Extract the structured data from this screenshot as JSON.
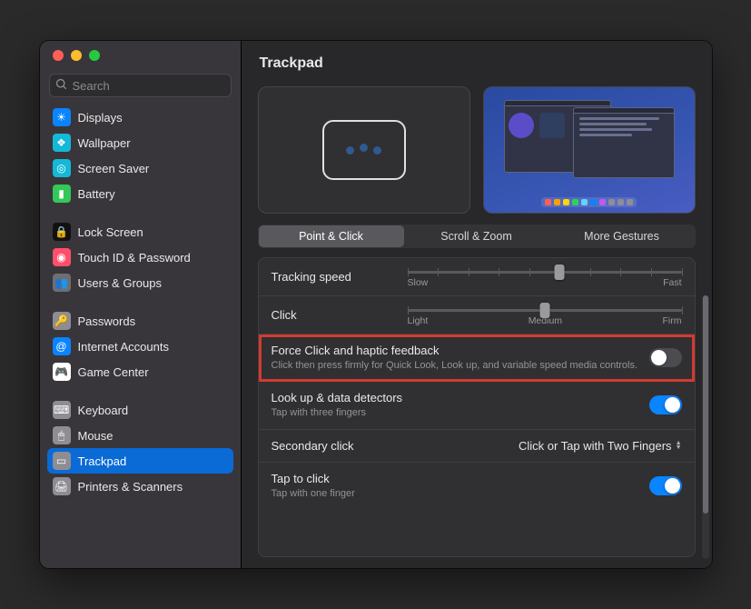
{
  "search": {
    "placeholder": "Search"
  },
  "header": {
    "title": "Trackpad"
  },
  "sidebar": {
    "groups": [
      [
        {
          "label": "Displays",
          "icon_bg": "#0a84ff",
          "glyph": "☀"
        },
        {
          "label": "Wallpaper",
          "icon_bg": "#14b8d8",
          "glyph": "❖"
        },
        {
          "label": "Screen Saver",
          "icon_bg": "#14b8d8",
          "glyph": "◎"
        },
        {
          "label": "Battery",
          "icon_bg": "#34c759",
          "glyph": "▮"
        }
      ],
      [
        {
          "label": "Lock Screen",
          "icon_bg": "#111111",
          "glyph": "🔒"
        },
        {
          "label": "Touch ID & Password",
          "icon_bg": "#ff4f6b",
          "glyph": "◉"
        },
        {
          "label": "Users & Groups",
          "icon_bg": "#6f6e73",
          "glyph": "👥"
        }
      ],
      [
        {
          "label": "Passwords",
          "icon_bg": "#8e8d91",
          "glyph": "🔑"
        },
        {
          "label": "Internet Accounts",
          "icon_bg": "#0a84ff",
          "glyph": "@"
        },
        {
          "label": "Game Center",
          "icon_bg": "#ffffff",
          "glyph": "🎮"
        }
      ],
      [
        {
          "label": "Keyboard",
          "icon_bg": "#8e8d91",
          "glyph": "⌨"
        },
        {
          "label": "Mouse",
          "icon_bg": "#8e8d91",
          "glyph": "🖱"
        },
        {
          "label": "Trackpad",
          "icon_bg": "#8e8d91",
          "glyph": "▭",
          "selected": true
        },
        {
          "label": "Printers & Scanners",
          "icon_bg": "#8e8d91",
          "glyph": "🖨"
        }
      ]
    ]
  },
  "tabs": {
    "items": [
      {
        "label": "Point & Click",
        "selected": true
      },
      {
        "label": "Scroll & Zoom",
        "selected": false
      },
      {
        "label": "More Gestures",
        "selected": false
      }
    ]
  },
  "sliders": {
    "tracking": {
      "label": "Tracking speed",
      "min_label": "Slow",
      "max_label": "Fast",
      "ticks": 10,
      "value_index": 5
    },
    "click": {
      "label": "Click",
      "labels": [
        "Light",
        "Medium",
        "Firm"
      ],
      "ticks": 3,
      "value_index": 1
    }
  },
  "options": {
    "force_click": {
      "title": "Force Click and haptic feedback",
      "sub": "Click then press firmly for Quick Look, Look up, and variable speed media controls.",
      "on": false
    },
    "lookup": {
      "title": "Look up & data detectors",
      "sub": "Tap with three fingers",
      "on": true
    },
    "secondary_click": {
      "title": "Secondary click",
      "value": "Click or Tap with Two Fingers"
    },
    "tap_to_click": {
      "title": "Tap to click",
      "sub": "Tap with one finger",
      "on": true
    }
  },
  "colors": {
    "accent": "#0a84ff",
    "highlight_border": "#d33a2f"
  }
}
